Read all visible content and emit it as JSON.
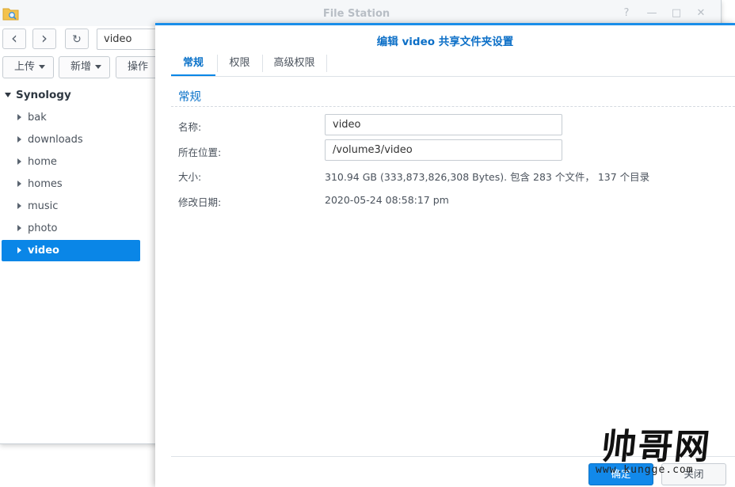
{
  "window": {
    "title": "File Station",
    "controls": [
      "?",
      "—",
      "□",
      "✕"
    ]
  },
  "nav": {
    "back_icon": "‹",
    "forward_icon": "›",
    "refresh_icon": "↻",
    "path": "video"
  },
  "toolbar": {
    "upload_label": "上传",
    "create_label": "新增",
    "action_label": "操作"
  },
  "tree": {
    "root": "Synology",
    "items": [
      "bak",
      "downloads",
      "home",
      "homes",
      "music",
      "photo",
      "video"
    ],
    "selected": "video"
  },
  "dialog": {
    "title": "编辑 video 共享文件夹设置",
    "tabs": [
      "常规",
      "权限",
      "高级权限"
    ],
    "active_tab": "常规",
    "section_title": "常规",
    "fields": {
      "name_label": "名称:",
      "name_value": "video",
      "location_label": "所在位置:",
      "location_value": "/volume3/video",
      "size_label": "大小:",
      "size_value": "310.94 GB (333,873,826,308 Bytes). 包含 283 个文件， 137 个目录",
      "modified_label": "修改日期:",
      "modified_value": "2020-05-24 08:58:17 pm"
    },
    "ok_label": "确定",
    "close_label": "关闭"
  },
  "watermark": {
    "main": "帅哥网",
    "url": "www.kungge.com"
  },
  "colors": {
    "accent": "#0a86e7",
    "dialog_title": "#0c6fc7"
  }
}
